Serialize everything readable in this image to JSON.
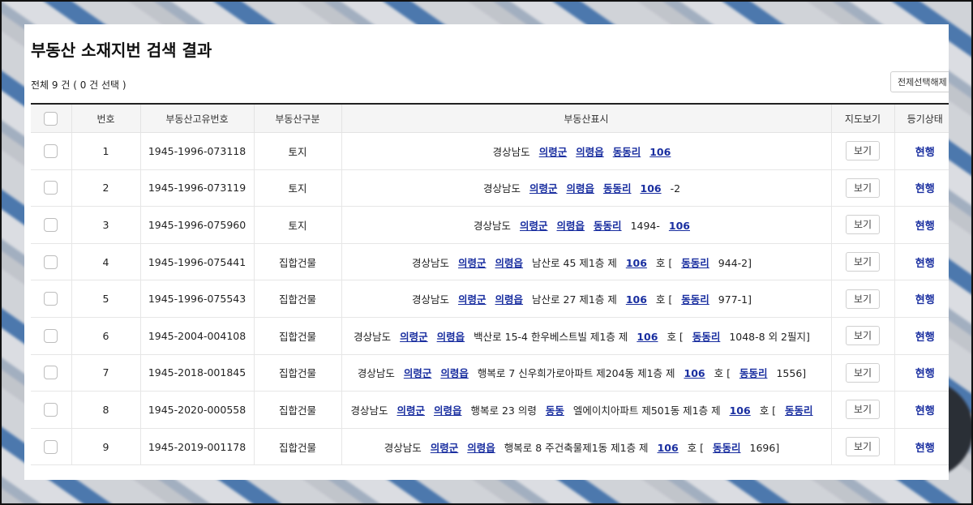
{
  "page": {
    "title": "부동산 소재지번 검색 결과",
    "count_text": "전체 9 건 ( 0 건 선택 )",
    "deselect_label": "전제선택해제"
  },
  "table": {
    "headers": [
      "",
      "번호",
      "부동산고유번호",
      "부동산구분",
      "부동산표시",
      "지도보기",
      "등기상태"
    ],
    "rows": [
      {
        "no": "1",
        "id": "1945-1996-073118",
        "type": "토지",
        "map": "보기",
        "status": "현행",
        "addr": [
          {
            "t": "경상남도"
          },
          {
            "t": "의령군",
            "l": true
          },
          {
            "t": "의령읍",
            "l": true
          },
          {
            "t": "동동리",
            "l": true
          },
          {
            "t": "106",
            "l": true
          }
        ]
      },
      {
        "no": "2",
        "id": "1945-1996-073119",
        "type": "토지",
        "map": "보기",
        "status": "현행",
        "addr": [
          {
            "t": "경상남도"
          },
          {
            "t": "의령군",
            "l": true
          },
          {
            "t": "의령읍",
            "l": true
          },
          {
            "t": "동동리",
            "l": true
          },
          {
            "t": "106",
            "l": true
          },
          {
            "t": "-2"
          }
        ]
      },
      {
        "no": "3",
        "id": "1945-1996-075960",
        "type": "토지",
        "map": "보기",
        "status": "현행",
        "addr": [
          {
            "t": "경상남도"
          },
          {
            "t": "의령군",
            "l": true
          },
          {
            "t": "의령읍",
            "l": true
          },
          {
            "t": "동동리",
            "l": true
          },
          {
            "t": "1494-"
          },
          {
            "t": "106",
            "l": true
          }
        ]
      },
      {
        "no": "4",
        "id": "1945-1996-075441",
        "type": "집합건물",
        "map": "보기",
        "status": "현행",
        "addr": [
          {
            "t": "경상남도"
          },
          {
            "t": "의령군",
            "l": true
          },
          {
            "t": "의령읍",
            "l": true
          },
          {
            "t": "남산로 45 제1층 제"
          },
          {
            "t": "106",
            "l": true
          },
          {
            "t": "호 ["
          },
          {
            "t": "동동리",
            "l": true
          },
          {
            "t": "944-2]"
          }
        ]
      },
      {
        "no": "5",
        "id": "1945-1996-075543",
        "type": "집합건물",
        "map": "보기",
        "status": "현행",
        "addr": [
          {
            "t": "경상남도"
          },
          {
            "t": "의령군",
            "l": true
          },
          {
            "t": "의령읍",
            "l": true
          },
          {
            "t": "남산로 27 제1층 제"
          },
          {
            "t": "106",
            "l": true
          },
          {
            "t": "호 ["
          },
          {
            "t": "동동리",
            "l": true
          },
          {
            "t": "977-1]"
          }
        ]
      },
      {
        "no": "6",
        "id": "1945-2004-004108",
        "type": "집합건물",
        "map": "보기",
        "status": "현행",
        "addr": [
          {
            "t": "경상남도"
          },
          {
            "t": "의령군",
            "l": true
          },
          {
            "t": "의령읍",
            "l": true
          },
          {
            "t": "백산로 15-4 한우베스트빌 제1층 제"
          },
          {
            "t": "106",
            "l": true
          },
          {
            "t": "호 ["
          },
          {
            "t": "동동리",
            "l": true
          },
          {
            "t": "1048-8 외 2필지]"
          }
        ]
      },
      {
        "no": "7",
        "id": "1945-2018-001845",
        "type": "집합건물",
        "map": "보기",
        "status": "현행",
        "addr": [
          {
            "t": "경상남도"
          },
          {
            "t": "의령군",
            "l": true
          },
          {
            "t": "의령읍",
            "l": true
          },
          {
            "t": "행복로 7 신우희가로아파트 제204동 제1층 제"
          },
          {
            "t": "106",
            "l": true
          },
          {
            "t": "호 ["
          },
          {
            "t": "동동리",
            "l": true
          },
          {
            "t": "1556]"
          }
        ]
      },
      {
        "no": "8",
        "id": "1945-2020-000558",
        "type": "집합건물",
        "map": "보기",
        "status": "현행",
        "addr": [
          {
            "t": "경상남도"
          },
          {
            "t": "의령군",
            "l": true
          },
          {
            "t": "의령읍",
            "l": true
          },
          {
            "t": "행복로 23 의령"
          },
          {
            "t": "동동",
            "l": true
          },
          {
            "t": "엘에이치아파트 제501동 제1층 제"
          },
          {
            "t": "106",
            "l": true
          },
          {
            "t": "호 ["
          },
          {
            "t": "동동리",
            "l": true
          }
        ]
      },
      {
        "no": "9",
        "id": "1945-2019-001178",
        "type": "집합건물",
        "map": "보기",
        "status": "현행",
        "addr": [
          {
            "t": "경상남도"
          },
          {
            "t": "의령군",
            "l": true
          },
          {
            "t": "의령읍",
            "l": true
          },
          {
            "t": "행복로 8 주건축물제1동 제1층 제"
          },
          {
            "t": "106",
            "l": true
          },
          {
            "t": "호 ["
          },
          {
            "t": "동동리",
            "l": true
          },
          {
            "t": "1696]"
          }
        ]
      }
    ]
  },
  "colors": {
    "link": "#1a2fa0",
    "header_bg": "#f5f5f5"
  }
}
